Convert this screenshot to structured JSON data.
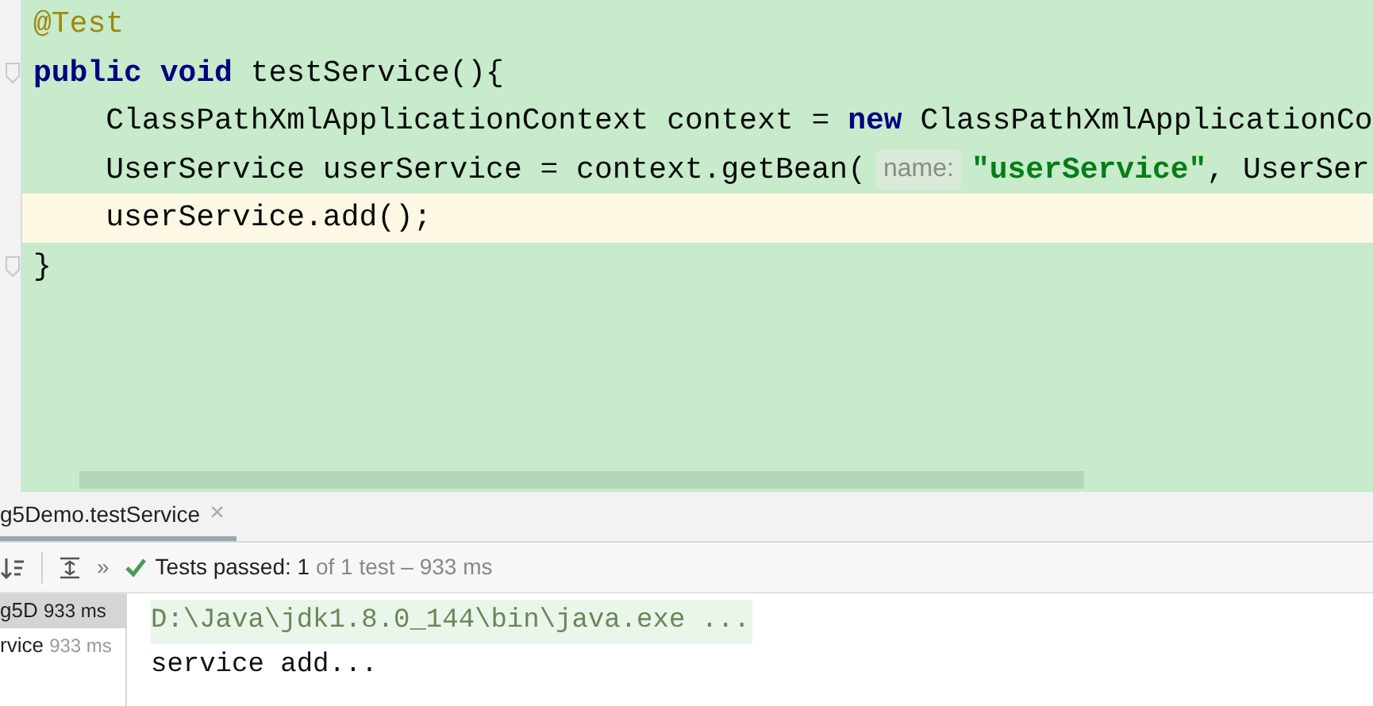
{
  "editor": {
    "lines": [
      {
        "current": false,
        "fold": false,
        "tokens": [
          {
            "kind": "annotation",
            "text": "@Test"
          }
        ]
      },
      {
        "current": false,
        "fold": true,
        "tokens": [
          {
            "kind": "keyword",
            "text": "public void "
          },
          {
            "kind": "plain",
            "text": "testService(){"
          }
        ]
      },
      {
        "current": false,
        "fold": false,
        "tokens": [
          {
            "kind": "plain",
            "text": "    ClassPathXmlApplicationContext context = "
          },
          {
            "kind": "keyword",
            "text": "new "
          },
          {
            "kind": "plain",
            "text": "ClassPathXmlApplicationCo"
          }
        ]
      },
      {
        "current": false,
        "fold": false,
        "tokens": [
          {
            "kind": "plain",
            "text": "    UserService userService = context.getBean("
          },
          {
            "kind": "hint",
            "text": "name:"
          },
          {
            "kind": "string",
            "text": "\"userService\""
          },
          {
            "kind": "plain",
            "text": ", UserSer"
          }
        ]
      },
      {
        "current": true,
        "fold": false,
        "tokens": [
          {
            "kind": "plain",
            "text": "    userService.add();"
          }
        ]
      },
      {
        "current": false,
        "fold": true,
        "tokens": [
          {
            "kind": "plain",
            "text": "}"
          }
        ]
      }
    ]
  },
  "run_panel": {
    "tab": {
      "label": "g5Demo.testService",
      "close": "×",
      "selected": true
    },
    "toolbar": {
      "more": "»",
      "status_bold": "Tests passed: 1",
      "status_rest": "of 1 test – 933 ms"
    },
    "tree": [
      {
        "name": "g5D",
        "time": "933 ms",
        "selected": true
      },
      {
        "name": "rvice",
        "time": "933 ms",
        "selected": false
      }
    ],
    "console": [
      {
        "kind": "command",
        "text": "D:\\Java\\jdk1.8.0_144\\bin\\java.exe ..."
      },
      {
        "kind": "output",
        "text": "service add..."
      }
    ]
  }
}
